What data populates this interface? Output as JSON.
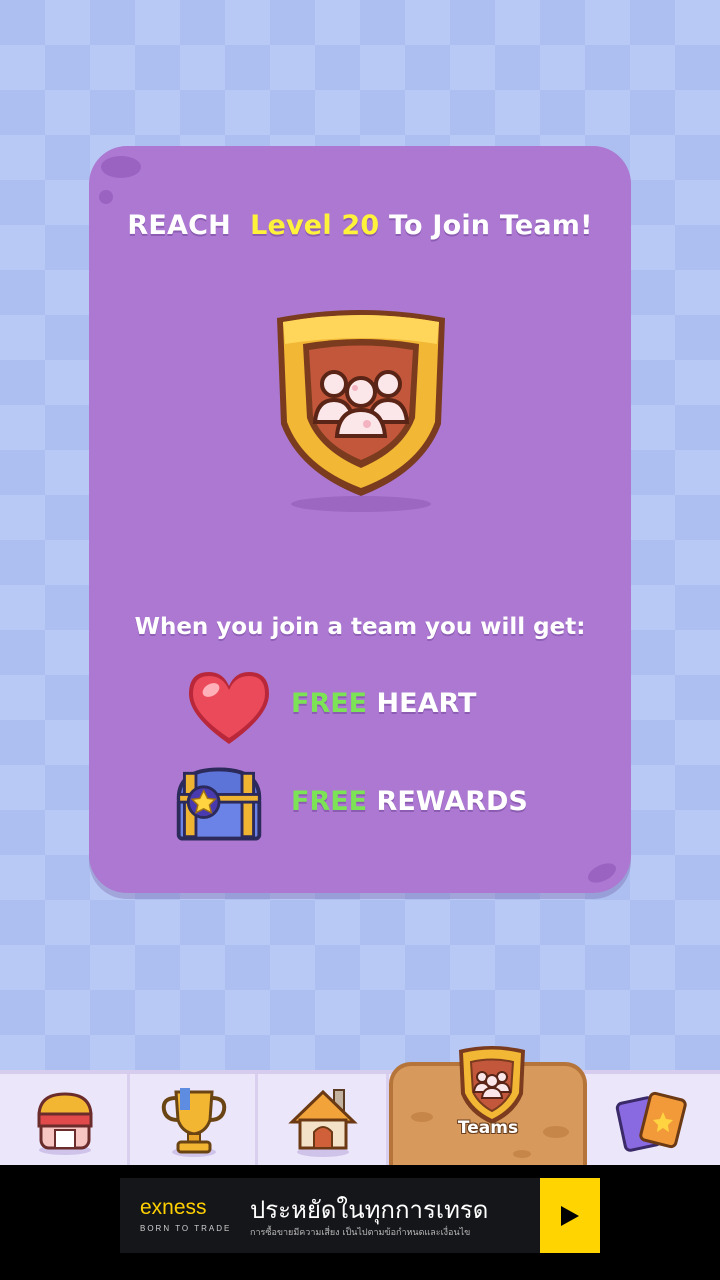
{
  "card": {
    "title_prefix": "REACH",
    "title_level": "Level 20",
    "title_suffix": "To Join Team!",
    "subtitle": "When you join a team you will get:",
    "perks": [
      {
        "icon": "heart-icon",
        "free": "FREE",
        "label": "HEART"
      },
      {
        "icon": "treasure-chest-icon",
        "free": "FREE",
        "label": "REWARDS"
      }
    ]
  },
  "navbar": {
    "items": [
      {
        "icon": "shop-icon"
      },
      {
        "icon": "trophy-icon"
      },
      {
        "icon": "home-icon"
      },
      {
        "icon": "teams-icon",
        "label": "Teams",
        "active": true
      },
      {
        "icon": "cards-icon"
      }
    ]
  },
  "ad": {
    "brand": "exness",
    "tagline": "BORN TO TRADE",
    "headline": "ประหยัดในทุกการเทรด",
    "subtext": "การซื้อขายมีความเสี่ยง เป็นไปตามข้อกำหนดและเงื่อนไข"
  },
  "colors": {
    "card": "#ac78d1",
    "level": "#fff23a",
    "free": "#7de356",
    "accent_tab": "#d89a5c"
  }
}
